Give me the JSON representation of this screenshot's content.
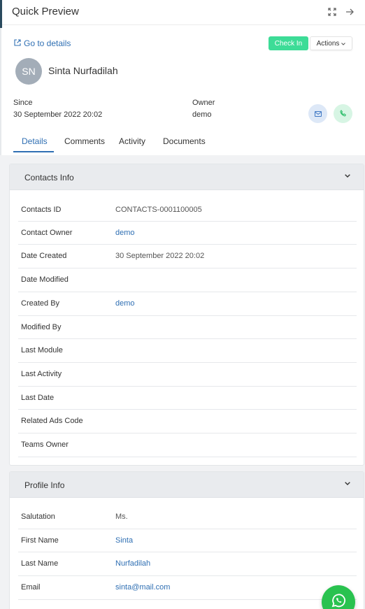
{
  "header": {
    "title": "Quick Preview"
  },
  "toolbar": {
    "goto_label": "Go to details",
    "checkin_label": "Check In",
    "actions_label": "Actions"
  },
  "contact": {
    "initials": "SN",
    "name": "Sinta Nurfadilah",
    "since_label": "Since",
    "since_value": "30 September 2022 20:02",
    "owner_label": "Owner",
    "owner_value": "demo"
  },
  "tabs": [
    {
      "label": "Details",
      "active": true
    },
    {
      "label": "Comments",
      "active": false
    },
    {
      "label": "Activity",
      "active": false
    },
    {
      "label": "Documents",
      "active": false
    }
  ],
  "contacts_info": {
    "title": "Contacts Info",
    "rows": [
      {
        "label": "Contacts ID",
        "value": "CONTACTS-0001100005"
      },
      {
        "label": "Contact Owner",
        "value": "demo"
      },
      {
        "label": "Date Created",
        "value": "30 September 2022 20:02"
      },
      {
        "label": "Date Modified",
        "value": ""
      },
      {
        "label": "Created By",
        "value": "demo"
      },
      {
        "label": "Modified By",
        "value": ""
      },
      {
        "label": "Last Module",
        "value": ""
      },
      {
        "label": "Last Activity",
        "value": ""
      },
      {
        "label": "Last Date",
        "value": ""
      },
      {
        "label": "Related Ads Code",
        "value": ""
      },
      {
        "label": "Teams Owner",
        "value": ""
      }
    ]
  },
  "profile_info": {
    "title": "Profile Info",
    "rows": [
      {
        "label": "Salutation",
        "value": "Ms."
      },
      {
        "label": "First Name",
        "value": "Sinta"
      },
      {
        "label": "Last Name",
        "value": "Nurfadilah"
      },
      {
        "label": "Email",
        "value": "sinta@mail.com"
      }
    ]
  },
  "colors": {
    "accent": "#2f6fb3",
    "checkin": "#3ddc97",
    "whatsapp": "#29c24f",
    "avatar": "#a3adb8"
  },
  "icons": [
    "external-link-icon",
    "expand-icon",
    "arrow-right-icon",
    "chevron-down-icon",
    "mail-icon",
    "phone-icon",
    "whatsapp-icon"
  ]
}
